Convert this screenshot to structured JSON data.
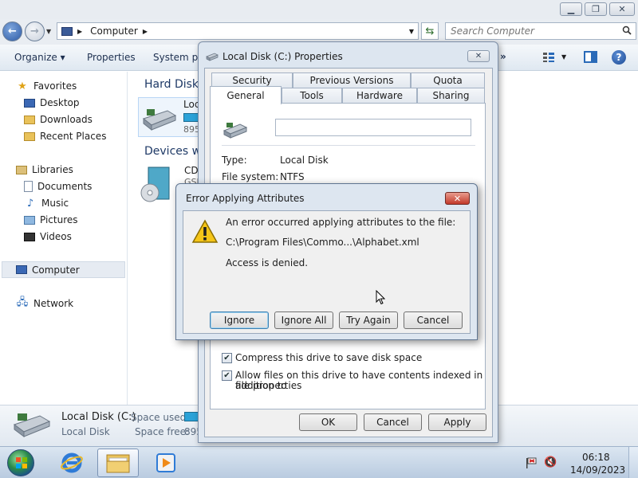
{
  "explorer": {
    "address": {
      "path": "Computer"
    },
    "search": {
      "placeholder": "Search Computer"
    },
    "toolbar": {
      "organize_label": "Organize ▾",
      "properties_label": "Properties",
      "system_properties_label": "System pro",
      "more_label": "»"
    },
    "navpane": {
      "favorites": "Favorites",
      "desktop": "Desktop",
      "downloads": "Downloads",
      "recent_places": "Recent Places",
      "libraries": "Libraries",
      "documents": "Documents",
      "music": "Music",
      "pictures": "Pictures",
      "videos": "Videos",
      "computer": "Computer",
      "network": "Network"
    },
    "content": {
      "hard_disk_heading": "Hard Disk",
      "drive_label": "Loc",
      "drive_size": "895",
      "devices_heading": "Devices w",
      "cd_label": "CD",
      "cd_sub": "GSF"
    },
    "details": {
      "name": "Local Disk (C:)",
      "type": "Local Disk",
      "space_used_label": "Space used:",
      "space_free_label": "Space free:",
      "space_free_value": "895"
    }
  },
  "taskbar": {
    "time": "06:18",
    "date": "14/09/2023"
  },
  "properties": {
    "title": "Local Disk (C:) Properties",
    "tabs": {
      "security": "Security",
      "previous_versions": "Previous Versions",
      "quota": "Quota",
      "general": "General",
      "tools": "Tools",
      "hardware": "Hardware",
      "sharing": "Sharing"
    },
    "name_value": "",
    "type_label": "Type:",
    "type_value": "Local Disk",
    "fs_label": "File system:",
    "fs_value": "NTFS",
    "compress_label": "Compress this drive to save disk space",
    "index_label_line1": "Allow files on this drive to have contents indexed in addition to",
    "index_label_line2": "file properties",
    "ok_label": "OK",
    "cancel_label": "Cancel",
    "apply_label": "Apply"
  },
  "error_dialog": {
    "title": "Error Applying Attributes",
    "message": "An error occurred applying attributes to the file:",
    "path": "C:\\Program Files\\Commo...\\Alphabet.xml",
    "denied": "Access is denied.",
    "ignore_label": "Ignore",
    "ignore_all_label": "Ignore All",
    "try_again_label": "Try Again",
    "cancel_label": "Cancel"
  },
  "colors": {
    "accent": "#2a6ab8",
    "drive_bar": "#2ba2d8",
    "close_red": "#c2392a"
  }
}
